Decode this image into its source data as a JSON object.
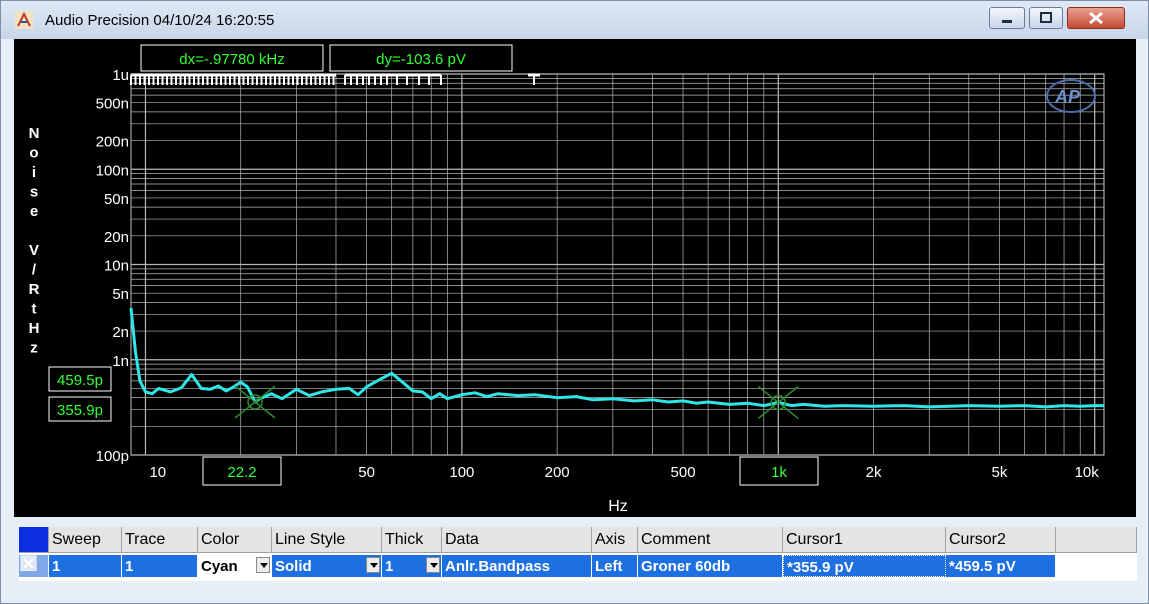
{
  "window": {
    "title": "Audio Precision  04/10/24 16:20:55"
  },
  "colors": {
    "trace": "#2ee6e6",
    "cursor_text": "#33ff33",
    "grid": "#b8b8b8",
    "selected_row": "#1e6fe0"
  },
  "cursors": {
    "dx": "dx=-.97780 kHz",
    "dy": "dy=-103.6  pV",
    "y1": "459.5p",
    "y2": "355.9p",
    "x1": "22.2",
    "x2": "1k"
  },
  "axis": {
    "ylabel_chars": [
      "N",
      "o",
      "i",
      "s",
      "e",
      "",
      "V",
      "/",
      "R",
      "t",
      "H",
      "z"
    ],
    "xlabel": "Hz",
    "y_ticks": [
      "1u",
      "500n",
      "200n",
      "100n",
      "50n",
      "20n",
      "10n",
      "5n",
      "2n",
      "1n",
      "100p"
    ],
    "x_ticks": [
      "10",
      "50",
      "100",
      "200",
      "500",
      "2k",
      "5k",
      "10k"
    ]
  },
  "chart_data": {
    "type": "line",
    "x_scale": "log",
    "y_scale": "log",
    "xlim": [
      9,
      10700
    ],
    "ylim": [
      1e-10,
      1e-06
    ],
    "xlabel": "Hz",
    "ylabel": "Noise V/RtHz",
    "grid": true,
    "series": [
      {
        "values": [
          [
            9,
            3.5e-09
          ],
          [
            9.3,
            1.2e-09
          ],
          [
            9.6,
            6e-10
          ],
          [
            10,
            4.6e-10
          ],
          [
            10.5,
            4.4e-10
          ],
          [
            11,
            5e-10
          ],
          [
            12,
            4.6e-10
          ],
          [
            13,
            5.1e-10
          ],
          [
            14,
            7e-10
          ],
          [
            15,
            5e-10
          ],
          [
            16,
            4.9e-10
          ],
          [
            17,
            5.3e-10
          ],
          [
            18,
            4.7e-10
          ],
          [
            19,
            5.2e-10
          ],
          [
            20,
            5.8e-10
          ],
          [
            21,
            5.2e-10
          ],
          [
            22.2,
            3.6e-10
          ],
          [
            23,
            3.9e-10
          ],
          [
            25,
            4.4e-10
          ],
          [
            27,
            3.9e-10
          ],
          [
            30,
            4.9e-10
          ],
          [
            33,
            4.2e-10
          ],
          [
            36,
            4.6e-10
          ],
          [
            40,
            4.9e-10
          ],
          [
            44,
            5e-10
          ],
          [
            47,
            4.3e-10
          ],
          [
            50,
            5.2e-10
          ],
          [
            55,
            6.2e-10
          ],
          [
            60,
            7.2e-10
          ],
          [
            65,
            5.8e-10
          ],
          [
            70,
            4.7e-10
          ],
          [
            75,
            4.6e-10
          ],
          [
            80,
            3.9e-10
          ],
          [
            85,
            4.4e-10
          ],
          [
            90,
            3.9e-10
          ],
          [
            100,
            4.3e-10
          ],
          [
            110,
            4.5e-10
          ],
          [
            120,
            4.1e-10
          ],
          [
            130,
            4.4e-10
          ],
          [
            150,
            4.2e-10
          ],
          [
            170,
            4.3e-10
          ],
          [
            200,
            4e-10
          ],
          [
            230,
            4.1e-10
          ],
          [
            260,
            3.8e-10
          ],
          [
            300,
            3.9e-10
          ],
          [
            350,
            3.7e-10
          ],
          [
            400,
            3.8e-10
          ],
          [
            450,
            3.6e-10
          ],
          [
            500,
            3.7e-10
          ],
          [
            550,
            3.5e-10
          ],
          [
            600,
            3.6e-10
          ],
          [
            700,
            3.4e-10
          ],
          [
            800,
            3.5e-10
          ],
          [
            900,
            3.3e-10
          ],
          [
            1000,
            3.56e-10
          ],
          [
            1100,
            3.3e-10
          ],
          [
            1200,
            3.4e-10
          ],
          [
            1400,
            3.25e-10
          ],
          [
            1600,
            3.3e-10
          ],
          [
            2000,
            3.25e-10
          ],
          [
            2500,
            3.3e-10
          ],
          [
            3000,
            3.2e-10
          ],
          [
            4000,
            3.3e-10
          ],
          [
            5000,
            3.25e-10
          ],
          [
            6000,
            3.3e-10
          ],
          [
            7000,
            3.2e-10
          ],
          [
            8000,
            3.3e-10
          ],
          [
            9000,
            3.25e-10
          ],
          [
            10000,
            3.3e-10
          ],
          [
            10700,
            3.3e-10
          ]
        ]
      }
    ]
  },
  "table": {
    "headers": [
      "Sweep",
      "Trace",
      "Color",
      "Line Style",
      "Thick",
      "Data",
      "Axis",
      "Comment",
      "Cursor1",
      "Cursor2"
    ],
    "row": {
      "sweep": "1",
      "trace": "1",
      "color": "Cyan",
      "line_style": "Solid",
      "thick": "1",
      "data": "Anlr.Bandpass",
      "axis": "Left",
      "comment": "Groner 60db",
      "cursor1": "*355.9  pV",
      "cursor2": "*459.5  pV"
    }
  }
}
